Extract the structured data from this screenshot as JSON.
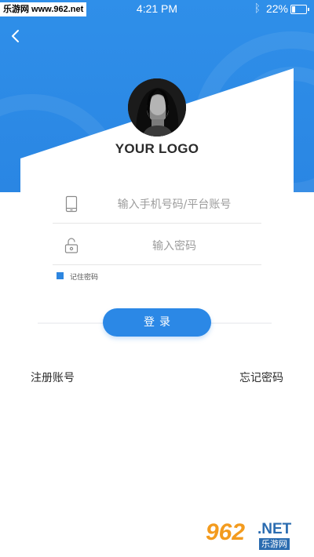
{
  "watermark": "乐游网 www.962.net",
  "status_bar": {
    "time": "4:21 PM",
    "battery_percent": "22%",
    "battery_level": 0.22,
    "bluetooth_icon": "bluetooth-icon"
  },
  "header": {
    "back_icon": "chevron-left-icon",
    "logo_text": "YOUR LOGO"
  },
  "form": {
    "phone_placeholder": "输入手机号码/平台账号",
    "phone_icon": "phone-icon",
    "password_placeholder": "输入密码",
    "password_icon": "lock-icon",
    "remember_label": "记住密码",
    "remember_checked": true,
    "login_label": "登录"
  },
  "links": {
    "register": "注册账号",
    "forgot_password": "忘记密码"
  },
  "corner_logo": {
    "number": "962",
    "domain": ".NET",
    "name": "乐游网"
  },
  "colors": {
    "primary": "#2b88e6",
    "header_bg": "#2f8fe9",
    "brand_orange": "#f39b1e",
    "brand_blue": "#2b6cb0"
  }
}
